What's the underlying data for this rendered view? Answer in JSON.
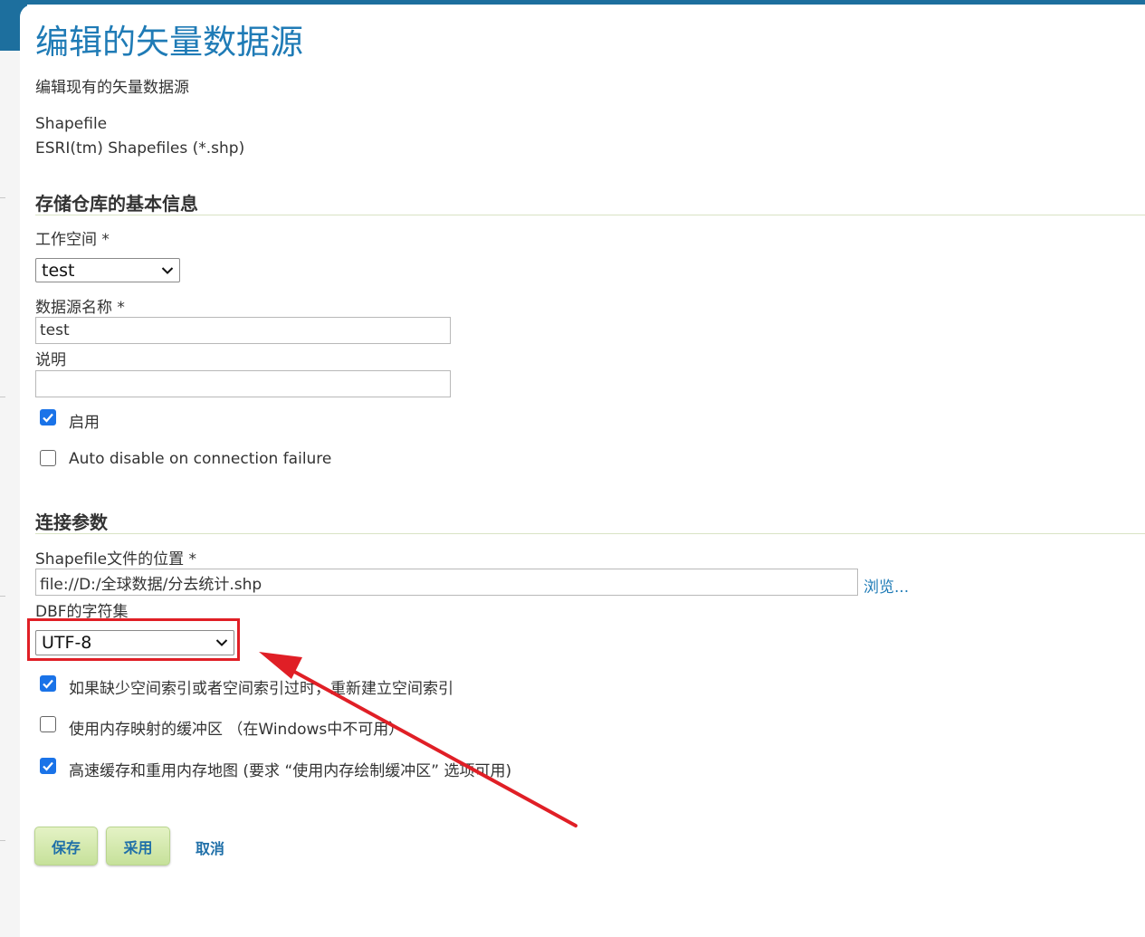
{
  "page": {
    "title": "编辑的矢量数据源",
    "subtitle": "编辑现有的矢量数据源",
    "datastore_type": "Shapefile",
    "datastore_description": "ESRI(tm) Shapefiles (*.shp)"
  },
  "basic_info": {
    "section_title": "存储仓库的基本信息",
    "workspace_label": "工作空间 *",
    "workspace_value": "test",
    "name_label": "数据源名称 *",
    "name_value": "test",
    "description_label": "说明",
    "description_value": "",
    "enabled_label": "启用",
    "enabled_checked": true,
    "auto_disable_label": "Auto disable on connection failure",
    "auto_disable_checked": false
  },
  "connection": {
    "section_title": "连接参数",
    "shapefile_location_label": "Shapefile文件的位置 *",
    "shapefile_location_value": "file://D:/全球数据/分去统计.shp",
    "browse_link": "浏览...",
    "charset_label": "DBF的字符集",
    "charset_value": "UTF-8",
    "options": [
      {
        "label": "如果缺少空间索引或者空间索引过时，重新建立空间索引",
        "checked": true
      },
      {
        "label": "使用内存映射的缓冲区 （在Windows中不可用）",
        "checked": false
      },
      {
        "label": "高速缓存和重用内存地图 (要求 “使用内存绘制缓冲区” 选项可用)",
        "checked": true
      }
    ]
  },
  "actions": {
    "save_label": "保存",
    "apply_label": "采用",
    "cancel_label": "取消"
  },
  "colors": {
    "title": "#1f7bb6",
    "accent": "#1d6f9e",
    "checkbox": "#1a73e8",
    "button_bg": "#c6e19a",
    "annotation": "#e01f26"
  }
}
